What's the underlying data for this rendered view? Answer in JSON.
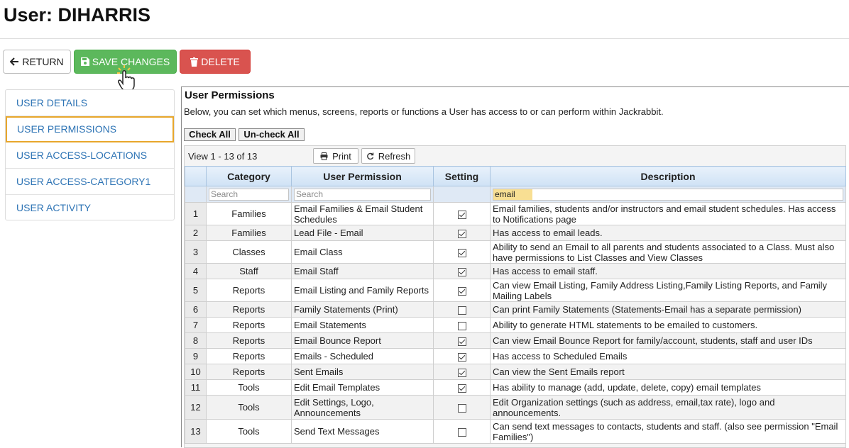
{
  "page": {
    "title": "User: DIHARRIS"
  },
  "toolbar": {
    "return_label": "RETURN",
    "save_label": "SAVE CHANGES",
    "delete_label": "DELETE"
  },
  "sidebar": {
    "items": [
      {
        "label": "USER DETAILS",
        "active": false
      },
      {
        "label": "USER PERMISSIONS",
        "active": true
      },
      {
        "label": "USER ACCESS-LOCATIONS",
        "active": false
      },
      {
        "label": "USER ACCESS-CATEGORY1",
        "active": false
      },
      {
        "label": "USER ACTIVITY",
        "active": false
      }
    ]
  },
  "panel": {
    "title": "User Permissions",
    "description": "Below, you can set which menus, screens, reports or functions a User has access to or can perform within Jackrabbit.",
    "check_all_label": "Check All",
    "uncheck_all_label": "Un-check All"
  },
  "grid": {
    "view_text": "View 1 - 13 of 13",
    "print_label": "Print",
    "refresh_label": "Refresh",
    "columns": [
      "Category",
      "User Permission",
      "Setting",
      "Description"
    ],
    "search": {
      "category_placeholder": "Search",
      "permission_placeholder": "Search",
      "description_value": "email"
    },
    "rows": [
      {
        "num": "1",
        "category": "Families",
        "permission": "Email Families & Email Student Schedules",
        "checked": true,
        "description": "Email families, students and/or instructors and email student schedules. Has access to Notifications page"
      },
      {
        "num": "2",
        "category": "Families",
        "permission": "Lead File - Email",
        "checked": true,
        "description": "Has access to email leads."
      },
      {
        "num": "3",
        "category": "Classes",
        "permission": "Email Class",
        "checked": true,
        "description": "Ability to send an Email to all parents and students associated to a Class. Must also have permissions to List Classes and View Classes"
      },
      {
        "num": "4",
        "category": "Staff",
        "permission": "Email Staff",
        "checked": true,
        "description": "Has access to email staff."
      },
      {
        "num": "5",
        "category": "Reports",
        "permission": "Email Listing and Family Reports",
        "checked": true,
        "description": "Can view Email Listing, Family Address Listing,Family Listing Reports, and Family Mailing Labels"
      },
      {
        "num": "6",
        "category": "Reports",
        "permission": "Family Statements (Print)",
        "checked": false,
        "description": "Can print Family Statements (Statements-Email has a separate permission)"
      },
      {
        "num": "7",
        "category": "Reports",
        "permission": "Email Statements",
        "checked": false,
        "description": "Ability to generate HTML statements to be emailed to customers."
      },
      {
        "num": "8",
        "category": "Reports",
        "permission": "Email Bounce Report",
        "checked": true,
        "description": "Can view Email Bounce Report for family/account, students, staff and user IDs"
      },
      {
        "num": "9",
        "category": "Reports",
        "permission": "Emails - Scheduled",
        "checked": true,
        "description": "Has access to Scheduled Emails"
      },
      {
        "num": "10",
        "category": "Reports",
        "permission": "Sent Emails",
        "checked": true,
        "description": "Can view the Sent Emails report"
      },
      {
        "num": "11",
        "category": "Tools",
        "permission": "Edit Email Templates",
        "checked": true,
        "description": "Has ability to manage (add, update, delete, copy) email templates"
      },
      {
        "num": "12",
        "category": "Tools",
        "permission": "Edit Settings, Logo, Announcements",
        "checked": false,
        "description": "Edit Organization settings (such as address, email,tax rate), logo and announcements."
      },
      {
        "num": "13",
        "category": "Tools",
        "permission": "Send Text Messages",
        "checked": false,
        "description": "Can send text messages to contacts, students and staff. (also see permission \"Email Families\")"
      }
    ]
  },
  "colors": {
    "save": "#5cb85c",
    "delete": "#d9534f",
    "link": "#2e74b5",
    "active_outline": "#e8a72c",
    "search_highlight": "#f8df93"
  },
  "icons": {
    "return": "arrow-left-icon",
    "save": "floppy-disk-icon",
    "delete": "trash-icon",
    "print": "printer-icon",
    "refresh": "refresh-icon",
    "cursor": "hand-pointer-icon"
  }
}
